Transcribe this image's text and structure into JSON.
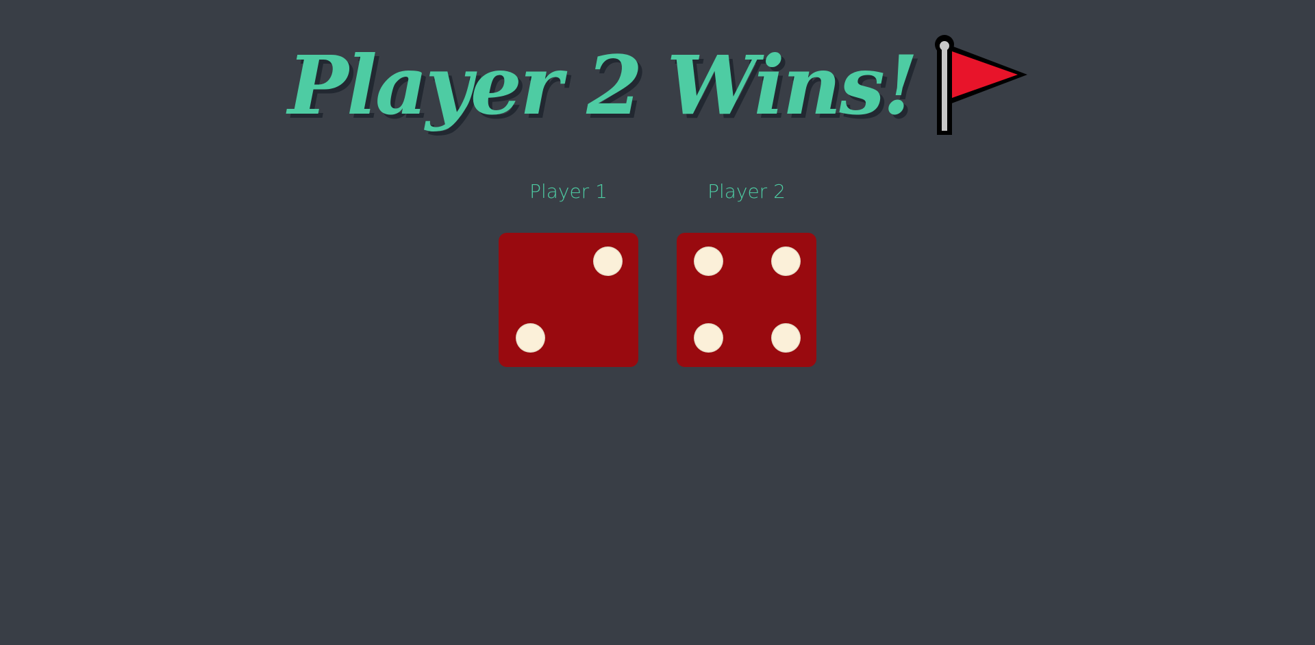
{
  "header": {
    "title": "Player 2 Wins!",
    "flag_icon": "red-flag-icon"
  },
  "players": [
    {
      "label": "Player 1",
      "die_value": 2
    },
    {
      "label": "Player 2",
      "die_value": 4
    }
  ],
  "colors": {
    "background": "#393e46",
    "accent": "#4ecca3",
    "die": "#990a0f",
    "pip": "#fbf0d9",
    "flag": "#e8142a"
  }
}
